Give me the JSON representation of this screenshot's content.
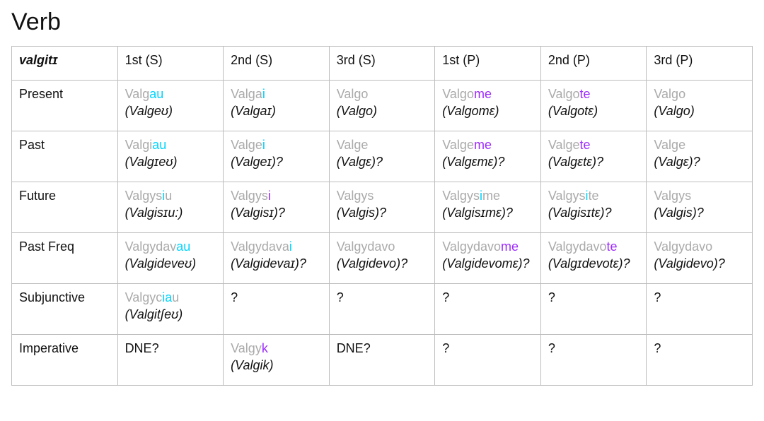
{
  "heading": "Verb",
  "corner": "valgitɪ",
  "cols": [
    "1st (S)",
    "2nd (S)",
    "3rd (S)",
    "1st (P)",
    "2nd (P)",
    "3rd (P)"
  ],
  "rows": [
    "Present",
    "Past",
    "Future",
    "Past Freq",
    "Subjunctive",
    "Imperative"
  ],
  "cells": {
    "Present": {
      "1st (S)": {
        "stem": "Valg",
        "hi": "au",
        "hiColor": "cyan",
        "ipa": "(Valgeʊ)",
        "after": ""
      },
      "2nd (S)": {
        "stem": "Valga",
        "hi": "i",
        "hiColor": "cyan",
        "ipa": "(Valgaɪ)",
        "after": ""
      },
      "3rd (S)": {
        "stem": "Valgo",
        "hi": "",
        "hiColor": "",
        "ipa": "(Valgo)",
        "after": ""
      },
      "1st (P)": {
        "stem": "Valgo",
        "hi": "me",
        "hiColor": "purple",
        "ipa": "(Valgomɛ)",
        "after": ""
      },
      "2nd (P)": {
        "stem": "Valgo",
        "hi": "te",
        "hiColor": "purple",
        "ipa": "(Valgotɛ)",
        "after": ""
      },
      "3rd (P)": {
        "stem": "Valgo",
        "hi": "",
        "hiColor": "",
        "ipa": "(Valgo)",
        "after": ""
      }
    },
    "Past": {
      "1st (S)": {
        "stem": "Valgi",
        "hi": "au",
        "hiColor": "cyan",
        "ipa": "(Valgɪeʊ)",
        "after": ""
      },
      "2nd (S)": {
        "stem": "Valge",
        "hi": "i",
        "hiColor": "cyan",
        "ipa": "(Valgeɪ)?",
        "after": ""
      },
      "3rd (S)": {
        "stem": "Valge",
        "hi": "",
        "hiColor": "",
        "ipa": "(Valgɛ)?",
        "after": ""
      },
      "1st (P)": {
        "stem": "Valge",
        "hi": "me",
        "hiColor": "purple",
        "ipa": "(Valgɛmɛ)?",
        "after": ""
      },
      "2nd (P)": {
        "stem": "Valge",
        "hi": "te",
        "hiColor": "purple",
        "ipa": "(Valgɛtɛ)?",
        "after": ""
      },
      "3rd (P)": {
        "stem": "Valge",
        "hi": "",
        "hiColor": "",
        "ipa": "(Valgɛ)?",
        "after": ""
      }
    },
    "Future": {
      "1st (S)": {
        "stem": "Valgys",
        "hi": "i",
        "hiColor": "cyan",
        "ipa": "(Valgisɪu:)",
        "after": "u"
      },
      "2nd (S)": {
        "stem": "Valgys",
        "hi": "i",
        "hiColor": "purple",
        "ipa": "(Valgisɪ)?",
        "after": ""
      },
      "3rd (S)": {
        "stem": "Valgys",
        "hi": "",
        "hiColor": "",
        "ipa": "(Valgis)?",
        "after": ""
      },
      "1st (P)": {
        "stem": "Valgys",
        "hi": "i",
        "hiColor": "cyan",
        "ipa": "(Valgisɪmɛ)?",
        "after": "me"
      },
      "2nd (P)": {
        "stem": "Valgys",
        "hi": "i",
        "hiColor": "cyan",
        "ipa": "(Valgisɪtɛ)?",
        "after": "te"
      },
      "3rd (P)": {
        "stem": "Valgys",
        "hi": "",
        "hiColor": "",
        "ipa": "(Valgis)?",
        "after": ""
      }
    },
    "Past Freq": {
      "1st (S)": {
        "stem": "Valgydav",
        "hi": "au",
        "hiColor": "cyan",
        "ipa": "(Valgideveʊ)",
        "after": ""
      },
      "2nd (S)": {
        "stem": "Valgydava",
        "hi": "i",
        "hiColor": "cyan",
        "ipa": "(Valgidevaɪ)?",
        "after": ""
      },
      "3rd (S)": {
        "stem": "Valgydavo",
        "hi": "",
        "hiColor": "",
        "ipa": "(Valgidevo)?",
        "after": ""
      },
      "1st (P)": {
        "stem": "Valgydavo",
        "hi": "me",
        "hiColor": "purple",
        "ipa": "(Valgidevomɛ)?",
        "after": ""
      },
      "2nd (P)": {
        "stem": "Valgydavo",
        "hi": "te",
        "hiColor": "purple",
        "ipa": "(Valgɪdevotɛ)?",
        "after": ""
      },
      "3rd (P)": {
        "stem": "Valgydavo",
        "hi": "",
        "hiColor": "",
        "ipa": "(Valgidevo)?",
        "after": ""
      }
    },
    "Subjunctive": {
      "1st (S)": {
        "stem": "Valgyc",
        "hi": "ia",
        "hiColor": "cyan",
        "ipa": "(Valgitʃeʊ)",
        "after": "u"
      },
      "2nd (S)": {
        "plain": "?"
      },
      "3rd (S)": {
        "plain": "?"
      },
      "1st (P)": {
        "plain": "?"
      },
      "2nd (P)": {
        "plain": "?"
      },
      "3rd (P)": {
        "plain": "?"
      }
    },
    "Imperative": {
      "1st (S)": {
        "plain": "DNE?"
      },
      "2nd (S)": {
        "stem": "Valgy",
        "hi": "k",
        "hiColor": "purple",
        "ipa": "(Valgik)",
        "after": ""
      },
      "3rd (S)": {
        "plain": "DNE?"
      },
      "1st (P)": {
        "plain": "?"
      },
      "2nd (P)": {
        "plain": "?"
      },
      "3rd (P)": {
        "plain": "?"
      }
    }
  }
}
